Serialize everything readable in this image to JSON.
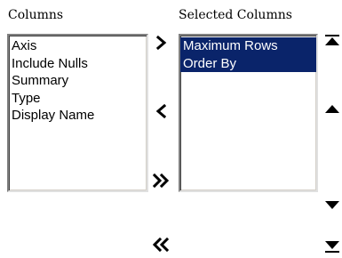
{
  "available": {
    "heading": "Columns",
    "items": [
      {
        "label": "Axis"
      },
      {
        "label": "Include Nulls"
      },
      {
        "label": "Summary"
      },
      {
        "label": "Type"
      },
      {
        "label": "Display Name"
      }
    ]
  },
  "selected": {
    "heading": "Selected Columns",
    "items": [
      {
        "label": "Maximum Rows",
        "highlighted": true
      },
      {
        "label": "Order By",
        "highlighted": true
      }
    ]
  },
  "icons": {
    "add": "chevron-right-icon",
    "remove": "chevron-left-icon",
    "add_all": "double-chevron-right-icon",
    "remove_all": "double-chevron-left-icon",
    "move_top": "move-to-top-icon",
    "move_up": "move-up-icon",
    "move_down": "move-down-icon",
    "move_bottom": "move-to-bottom-icon"
  },
  "colors": {
    "selection_bg": "#0a246a",
    "selection_text": "#ffffff"
  }
}
